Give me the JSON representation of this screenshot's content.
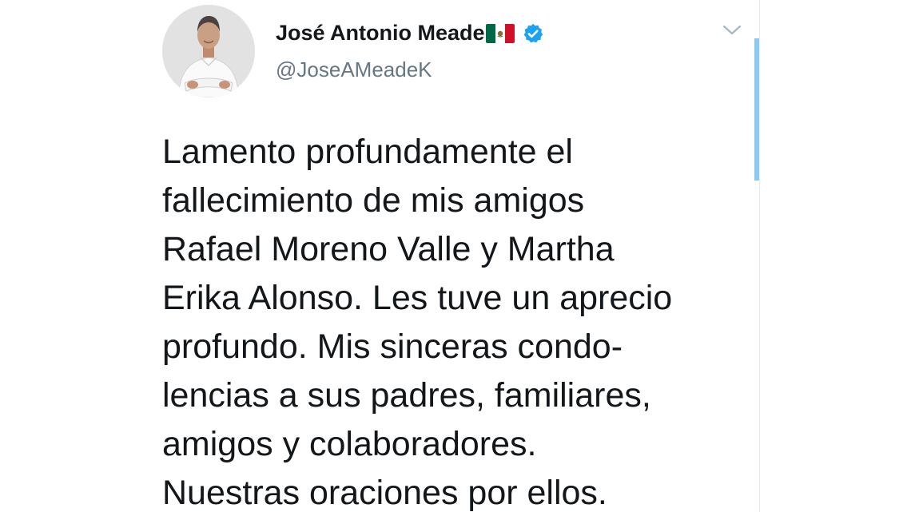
{
  "tweet": {
    "author": {
      "display_name": "José Antonio Meade",
      "name_emoji_icon": "mexico-flag-icon",
      "verified_icon": "verified-badge-icon",
      "handle": "@JoseAMeadeK"
    },
    "menu_icon": "chevron-down-icon",
    "text_lines": [
      "Lamento profundamente el",
      "fallecimiento de mis amigos",
      "Rafael Moreno Valle y Martha",
      "Erika Alonso. Les tuve un aprecio",
      "profundo. Mis sinceras condo-",
      "lencias a sus padres, familiares,",
      "amigos y colaboradores.",
      "Nuestras oraciones por ellos."
    ]
  },
  "colors": {
    "text": "#14171a",
    "handle": "#657786",
    "verified": "#1da1f2",
    "scrollbar": "#8ccaf4"
  }
}
